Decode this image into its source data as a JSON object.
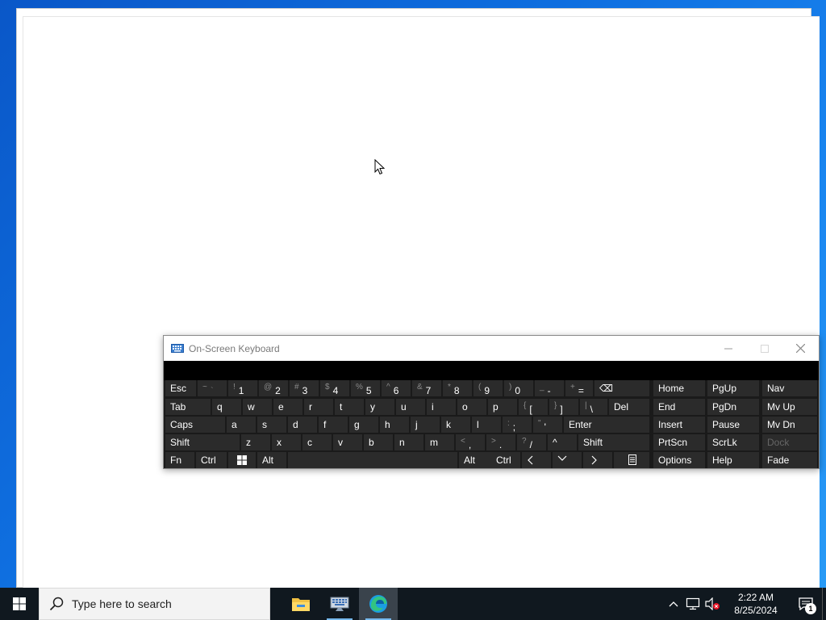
{
  "osk": {
    "title": "On-Screen Keyboard",
    "rows": [
      [
        {
          "p": "Esc"
        },
        {
          "s": "~",
          "p": "`",
          "dim": true
        },
        {
          "s": "!",
          "p": "1"
        },
        {
          "s": "@",
          "p": "2"
        },
        {
          "s": "#",
          "p": "3"
        },
        {
          "s": "$",
          "p": "4"
        },
        {
          "s": "%",
          "p": "5"
        },
        {
          "s": "^",
          "p": "6"
        },
        {
          "s": "&",
          "p": "7"
        },
        {
          "s": "*",
          "p": "8"
        },
        {
          "s": "(",
          "p": "9"
        },
        {
          "s": ")",
          "p": "0"
        },
        {
          "s": "_",
          "p": "-"
        },
        {
          "s": "+",
          "p": "="
        },
        {
          "p": "⌫"
        }
      ],
      [
        {
          "p": "Tab"
        },
        {
          "p": "q"
        },
        {
          "p": "w"
        },
        {
          "p": "e"
        },
        {
          "p": "r"
        },
        {
          "p": "t"
        },
        {
          "p": "y"
        },
        {
          "p": "u"
        },
        {
          "p": "i"
        },
        {
          "p": "o"
        },
        {
          "p": "p"
        },
        {
          "s": "{",
          "p": "["
        },
        {
          "s": "}",
          "p": "]"
        },
        {
          "s": "|",
          "p": "\\"
        },
        {
          "p": "Del"
        }
      ],
      [
        {
          "p": "Caps"
        },
        {
          "p": "a"
        },
        {
          "p": "s"
        },
        {
          "p": "d"
        },
        {
          "p": "f"
        },
        {
          "p": "g"
        },
        {
          "p": "h"
        },
        {
          "p": "j"
        },
        {
          "p": "k"
        },
        {
          "p": "l"
        },
        {
          "s": ":",
          "p": ";"
        },
        {
          "s": "\"",
          "p": "'"
        },
        {
          "p": "Enter"
        }
      ],
      [
        {
          "p": "Shift"
        },
        {
          "p": "z"
        },
        {
          "p": "x"
        },
        {
          "p": "c"
        },
        {
          "p": "v"
        },
        {
          "p": "b"
        },
        {
          "p": "n"
        },
        {
          "p": "m"
        },
        {
          "s": "<",
          "p": ","
        },
        {
          "s": ">",
          "p": "."
        },
        {
          "s": "?",
          "p": "/"
        },
        {
          "p": "^"
        },
        {
          "p": "Shift"
        }
      ],
      [
        {
          "p": "Fn"
        },
        {
          "p": "Ctrl"
        },
        {
          "p": ""
        },
        {
          "p": "Alt"
        },
        {
          "p": ""
        },
        {
          "p": "Alt"
        },
        {
          "p": "Ctrl"
        },
        {
          "p": ""
        },
        {
          "p": ""
        },
        {
          "p": ""
        },
        {
          "p": ""
        }
      ]
    ],
    "nav_rows": [
      [
        "Home",
        "PgUp",
        "Nav"
      ],
      [
        "End",
        "PgDn",
        "Mv Up"
      ],
      [
        "Insert",
        "Pause",
        "Mv Dn"
      ],
      [
        "PrtScn",
        "ScrLk",
        "Dock"
      ],
      [
        "Options",
        "Help",
        "Fade"
      ]
    ]
  },
  "taskbar": {
    "search_placeholder": "Type here to search",
    "time": "2:22 AM",
    "date": "8/25/2024",
    "notification_count": "1"
  },
  "colors": {
    "taskbar": "#10181f",
    "osk_key": "#2b2b2b",
    "accent": "#76b9ed"
  }
}
